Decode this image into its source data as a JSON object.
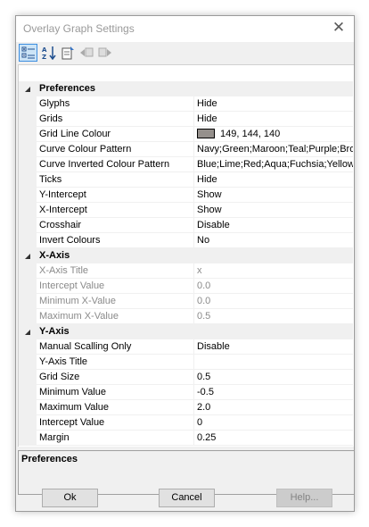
{
  "window": {
    "title": "Overlay Graph Settings",
    "close_glyph": "✕"
  },
  "toolbar": {
    "buttons": [
      {
        "name": "categorized-view-icon",
        "active": true
      },
      {
        "name": "alphabetical-sort-icon",
        "active": false
      },
      {
        "name": "property-pages-icon",
        "active": false
      },
      {
        "name": "back-arrow-icon",
        "active": false
      },
      {
        "name": "forward-arrow-icon",
        "active": false
      }
    ]
  },
  "grid": {
    "preferences": {
      "label": "Preferences",
      "rows": [
        {
          "name": "Glyphs",
          "value": "Hide"
        },
        {
          "name": "Grids",
          "value": "Hide"
        },
        {
          "name": "Grid Line Colour",
          "value": "149, 144, 140",
          "color": "#95908c"
        },
        {
          "name": "Curve Colour Pattern",
          "value": "Navy;Green;Maroon;Teal;Purple;Brown"
        },
        {
          "name": "Curve Inverted Colour Pattern",
          "value": "Blue;Lime;Red;Aqua;Fuchsia;Yellow"
        },
        {
          "name": "Ticks",
          "value": "Hide"
        },
        {
          "name": "Y-Intercept",
          "value": "Show"
        },
        {
          "name": "X-Intercept",
          "value": "Show"
        },
        {
          "name": "Crosshair",
          "value": "Disable"
        },
        {
          "name": "Invert Colours",
          "value": "No"
        }
      ]
    },
    "xaxis": {
      "label": "X-Axis",
      "rows": [
        {
          "name": "X-Axis Title",
          "value": "x"
        },
        {
          "name": "Intercept Value",
          "value": "0.0"
        },
        {
          "name": "Minimum X-Value",
          "value": "0.0"
        },
        {
          "name": "Maximum X-Value",
          "value": "0.5"
        }
      ]
    },
    "yaxis": {
      "label": "Y-Axis",
      "rows": [
        {
          "name": "Manual Scalling Only",
          "value": "Disable"
        },
        {
          "name": "Y-Axis Title",
          "value": ""
        },
        {
          "name": "Grid Size",
          "value": "0.5"
        },
        {
          "name": "Minimum Value",
          "value": "-0.5"
        },
        {
          "name": "Maximum Value",
          "value": "2.0"
        },
        {
          "name": "Intercept Value",
          "value": "0"
        },
        {
          "name": "Margin",
          "value": "0.25"
        }
      ]
    }
  },
  "description": {
    "title": "Preferences"
  },
  "buttons": {
    "ok": "Ok",
    "cancel": "Cancel",
    "help": "Help..."
  }
}
